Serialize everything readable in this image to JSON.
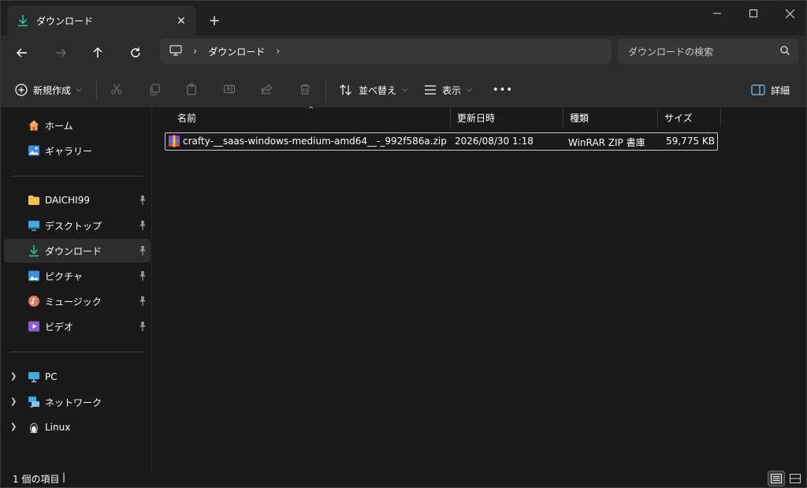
{
  "tab": {
    "title": "ダウンロード",
    "close": "✕",
    "new_tab": "+"
  },
  "window_controls": {
    "minimize": "—",
    "maximize": "☐",
    "close": "✕"
  },
  "address": {
    "breadcrumb": [
      "ダウンロード"
    ]
  },
  "search": {
    "placeholder": "ダウンロードの検索"
  },
  "commands": {
    "new": "新規作成",
    "sort": "並べ替え",
    "view": "表示",
    "more": "•••",
    "details": "詳細"
  },
  "sidebar": {
    "top": [
      {
        "label": "ホーム",
        "icon": "home-icon"
      },
      {
        "label": "ギャラリー",
        "icon": "gallery-icon"
      }
    ],
    "pinned": [
      {
        "label": "DAICHI99",
        "icon": "folder-icon"
      },
      {
        "label": "デスクトップ",
        "icon": "desktop-icon"
      },
      {
        "label": "ダウンロード",
        "icon": "download-icon",
        "selected": true
      },
      {
        "label": "ピクチャ",
        "icon": "pictures-icon"
      },
      {
        "label": "ミュージック",
        "icon": "music-icon"
      },
      {
        "label": "ビデオ",
        "icon": "video-icon"
      }
    ],
    "devices": [
      {
        "label": "PC",
        "icon": "pc-icon"
      },
      {
        "label": "ネットワーク",
        "icon": "network-icon"
      },
      {
        "label": "Linux",
        "icon": "linux-icon"
      }
    ]
  },
  "columns": {
    "name": "名前",
    "modified": "更新日時",
    "type": "種類",
    "size": "サイズ"
  },
  "files": [
    {
      "name": "crafty-__saas-windows-medium-amd64__-_992f586a.zip",
      "modified": "2026/08/30 1:18",
      "type": "WinRAR ZIP 書庫",
      "size": "59,775 KB"
    }
  ],
  "status": {
    "count": "1 個の項目",
    "cursor": "|"
  },
  "colors": {
    "accent": "#2bbf9a",
    "background": "#191919",
    "bar": "#2c2c2c"
  }
}
